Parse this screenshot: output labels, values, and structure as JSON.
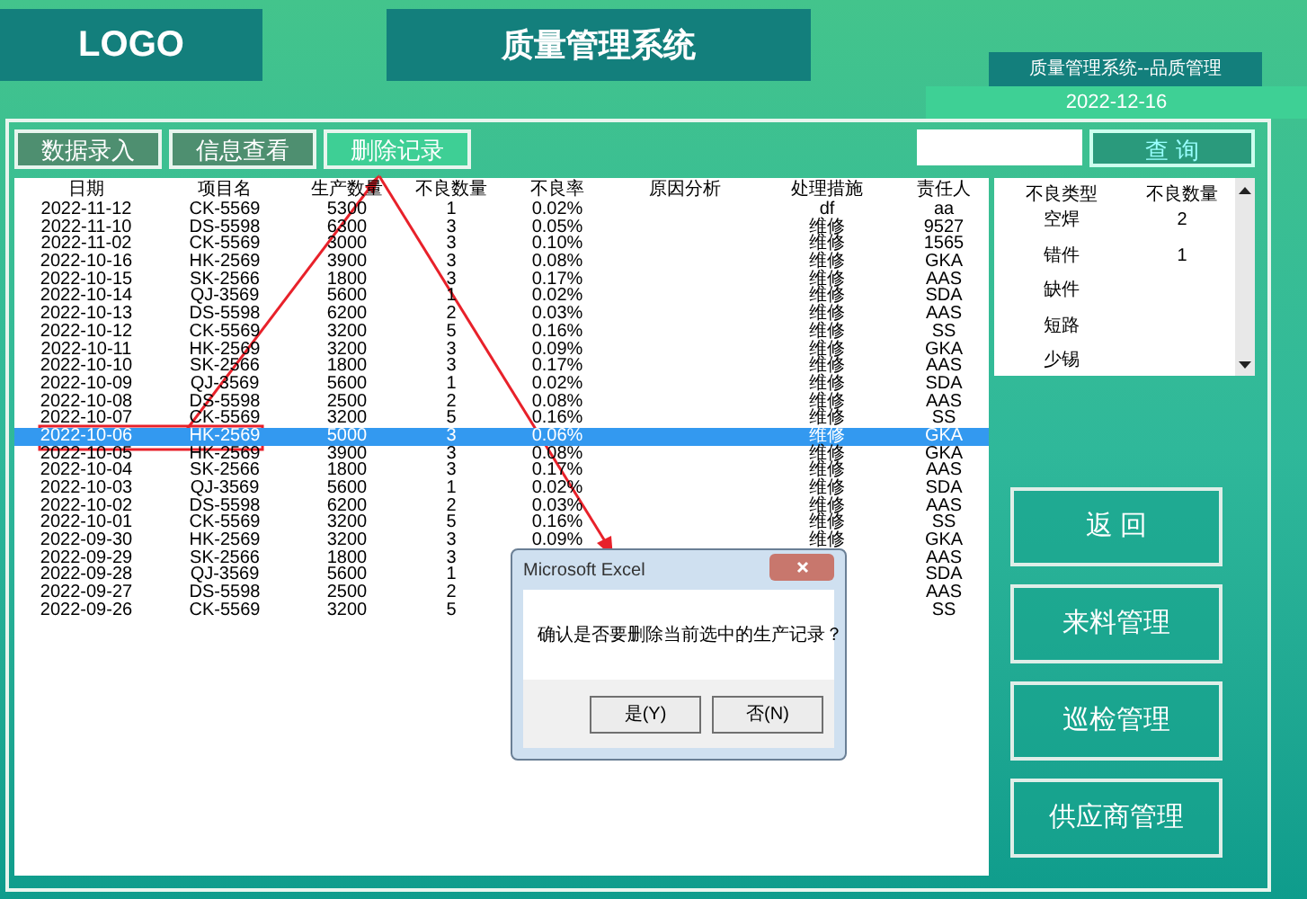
{
  "header": {
    "logo": "LOGO",
    "title": "质量管理系统",
    "subtitle": "质量管理系统--品质管理",
    "date": "2022-12-16"
  },
  "tabs": [
    {
      "label": "数据录入",
      "selected": false
    },
    {
      "label": "信息查看",
      "selected": false
    },
    {
      "label": "删除记录",
      "selected": true
    }
  ],
  "search": {
    "button": "查 询"
  },
  "table": {
    "columns": [
      "日期",
      "项目名",
      "生产数量",
      "不良数量",
      "不良率",
      "原因分析",
      "处理措施",
      "责任人"
    ],
    "rows": [
      {
        "date": "2022-11-12",
        "item": "CK-5569",
        "qty": "5300",
        "defects": "1",
        "rate": "0.02%",
        "measure": "df",
        "owner": "aa",
        "selected": false
      },
      {
        "date": "2022-11-10",
        "item": "DS-5598",
        "qty": "6300",
        "defects": "3",
        "rate": "0.05%",
        "measure": "维修",
        "owner": "9527",
        "selected": false
      },
      {
        "date": "2022-11-02",
        "item": "CK-5569",
        "qty": "3000",
        "defects": "3",
        "rate": "0.10%",
        "measure": "维修",
        "owner": "1565",
        "selected": false
      },
      {
        "date": "2022-10-16",
        "item": "HK-2569",
        "qty": "3900",
        "defects": "3",
        "rate": "0.08%",
        "measure": "维修",
        "owner": "GKA",
        "selected": false
      },
      {
        "date": "2022-10-15",
        "item": "SK-2566",
        "qty": "1800",
        "defects": "3",
        "rate": "0.17%",
        "measure": "维修",
        "owner": "AAS",
        "selected": false
      },
      {
        "date": "2022-10-14",
        "item": "QJ-3569",
        "qty": "5600",
        "defects": "1",
        "rate": "0.02%",
        "measure": "维修",
        "owner": "SDA",
        "selected": false
      },
      {
        "date": "2022-10-13",
        "item": "DS-5598",
        "qty": "6200",
        "defects": "2",
        "rate": "0.03%",
        "measure": "维修",
        "owner": "AAS",
        "selected": false
      },
      {
        "date": "2022-10-12",
        "item": "CK-5569",
        "qty": "3200",
        "defects": "5",
        "rate": "0.16%",
        "measure": "维修",
        "owner": "SS",
        "selected": false
      },
      {
        "date": "2022-10-11",
        "item": "HK-2569",
        "qty": "3200",
        "defects": "3",
        "rate": "0.09%",
        "measure": "维修",
        "owner": "GKA",
        "selected": false
      },
      {
        "date": "2022-10-10",
        "item": "SK-2566",
        "qty": "1800",
        "defects": "3",
        "rate": "0.17%",
        "measure": "维修",
        "owner": "AAS",
        "selected": false
      },
      {
        "date": "2022-10-09",
        "item": "QJ-3569",
        "qty": "5600",
        "defects": "1",
        "rate": "0.02%",
        "measure": "维修",
        "owner": "SDA",
        "selected": false
      },
      {
        "date": "2022-10-08",
        "item": "DS-5598",
        "qty": "2500",
        "defects": "2",
        "rate": "0.08%",
        "measure": "维修",
        "owner": "AAS",
        "selected": false
      },
      {
        "date": "2022-10-07",
        "item": "CK-5569",
        "qty": "3200",
        "defects": "5",
        "rate": "0.16%",
        "measure": "维修",
        "owner": "SS",
        "selected": false
      },
      {
        "date": "2022-10-06",
        "item": "HK-2569",
        "qty": "5000",
        "defects": "3",
        "rate": "0.06%",
        "measure": "维修",
        "owner": "GKA",
        "selected": true
      },
      {
        "date": "2022-10-05",
        "item": "HK-2569",
        "qty": "3900",
        "defects": "3",
        "rate": "0.08%",
        "measure": "维修",
        "owner": "GKA",
        "selected": false
      },
      {
        "date": "2022-10-04",
        "item": "SK-2566",
        "qty": "1800",
        "defects": "3",
        "rate": "0.17%",
        "measure": "维修",
        "owner": "AAS",
        "selected": false
      },
      {
        "date": "2022-10-03",
        "item": "QJ-3569",
        "qty": "5600",
        "defects": "1",
        "rate": "0.02%",
        "measure": "维修",
        "owner": "SDA",
        "selected": false
      },
      {
        "date": "2022-10-02",
        "item": "DS-5598",
        "qty": "6200",
        "defects": "2",
        "rate": "0.03%",
        "measure": "维修",
        "owner": "AAS",
        "selected": false
      },
      {
        "date": "2022-10-01",
        "item": "CK-5569",
        "qty": "3200",
        "defects": "5",
        "rate": "0.16%",
        "measure": "维修",
        "owner": "SS",
        "selected": false
      },
      {
        "date": "2022-09-30",
        "item": "HK-2569",
        "qty": "3200",
        "defects": "3",
        "rate": "0.09%",
        "measure": "维修",
        "owner": "GKA",
        "selected": false
      },
      {
        "date": "2022-09-29",
        "item": "SK-2566",
        "qty": "1800",
        "defects": "3",
        "owner": "AAS",
        "selected": false
      },
      {
        "date": "2022-09-28",
        "item": "QJ-3569",
        "qty": "5600",
        "defects": "1",
        "owner": "SDA",
        "selected": false
      },
      {
        "date": "2022-09-27",
        "item": "DS-5598",
        "qty": "2500",
        "defects": "2",
        "owner": "AAS",
        "selected": false
      },
      {
        "date": "2022-09-26",
        "item": "CK-5569",
        "qty": "3200",
        "defects": "5",
        "owner": "SS",
        "selected": false
      }
    ]
  },
  "defect_list": {
    "columns": [
      "不良类型",
      "不良数量"
    ],
    "rows": [
      [
        "空焊",
        "2"
      ],
      [
        "错件",
        "1"
      ],
      [
        "缺件"
      ],
      [
        "短路"
      ],
      [
        "少锡"
      ]
    ]
  },
  "nav_buttons": [
    "返 回",
    "来料管理",
    "巡检管理",
    "供应商管理"
  ],
  "dialog": {
    "title": "Microsoft Excel",
    "message": "确认是否要删除当前选中的生产记录？",
    "buttons": [
      "是(Y)",
      "否(N)"
    ]
  }
}
